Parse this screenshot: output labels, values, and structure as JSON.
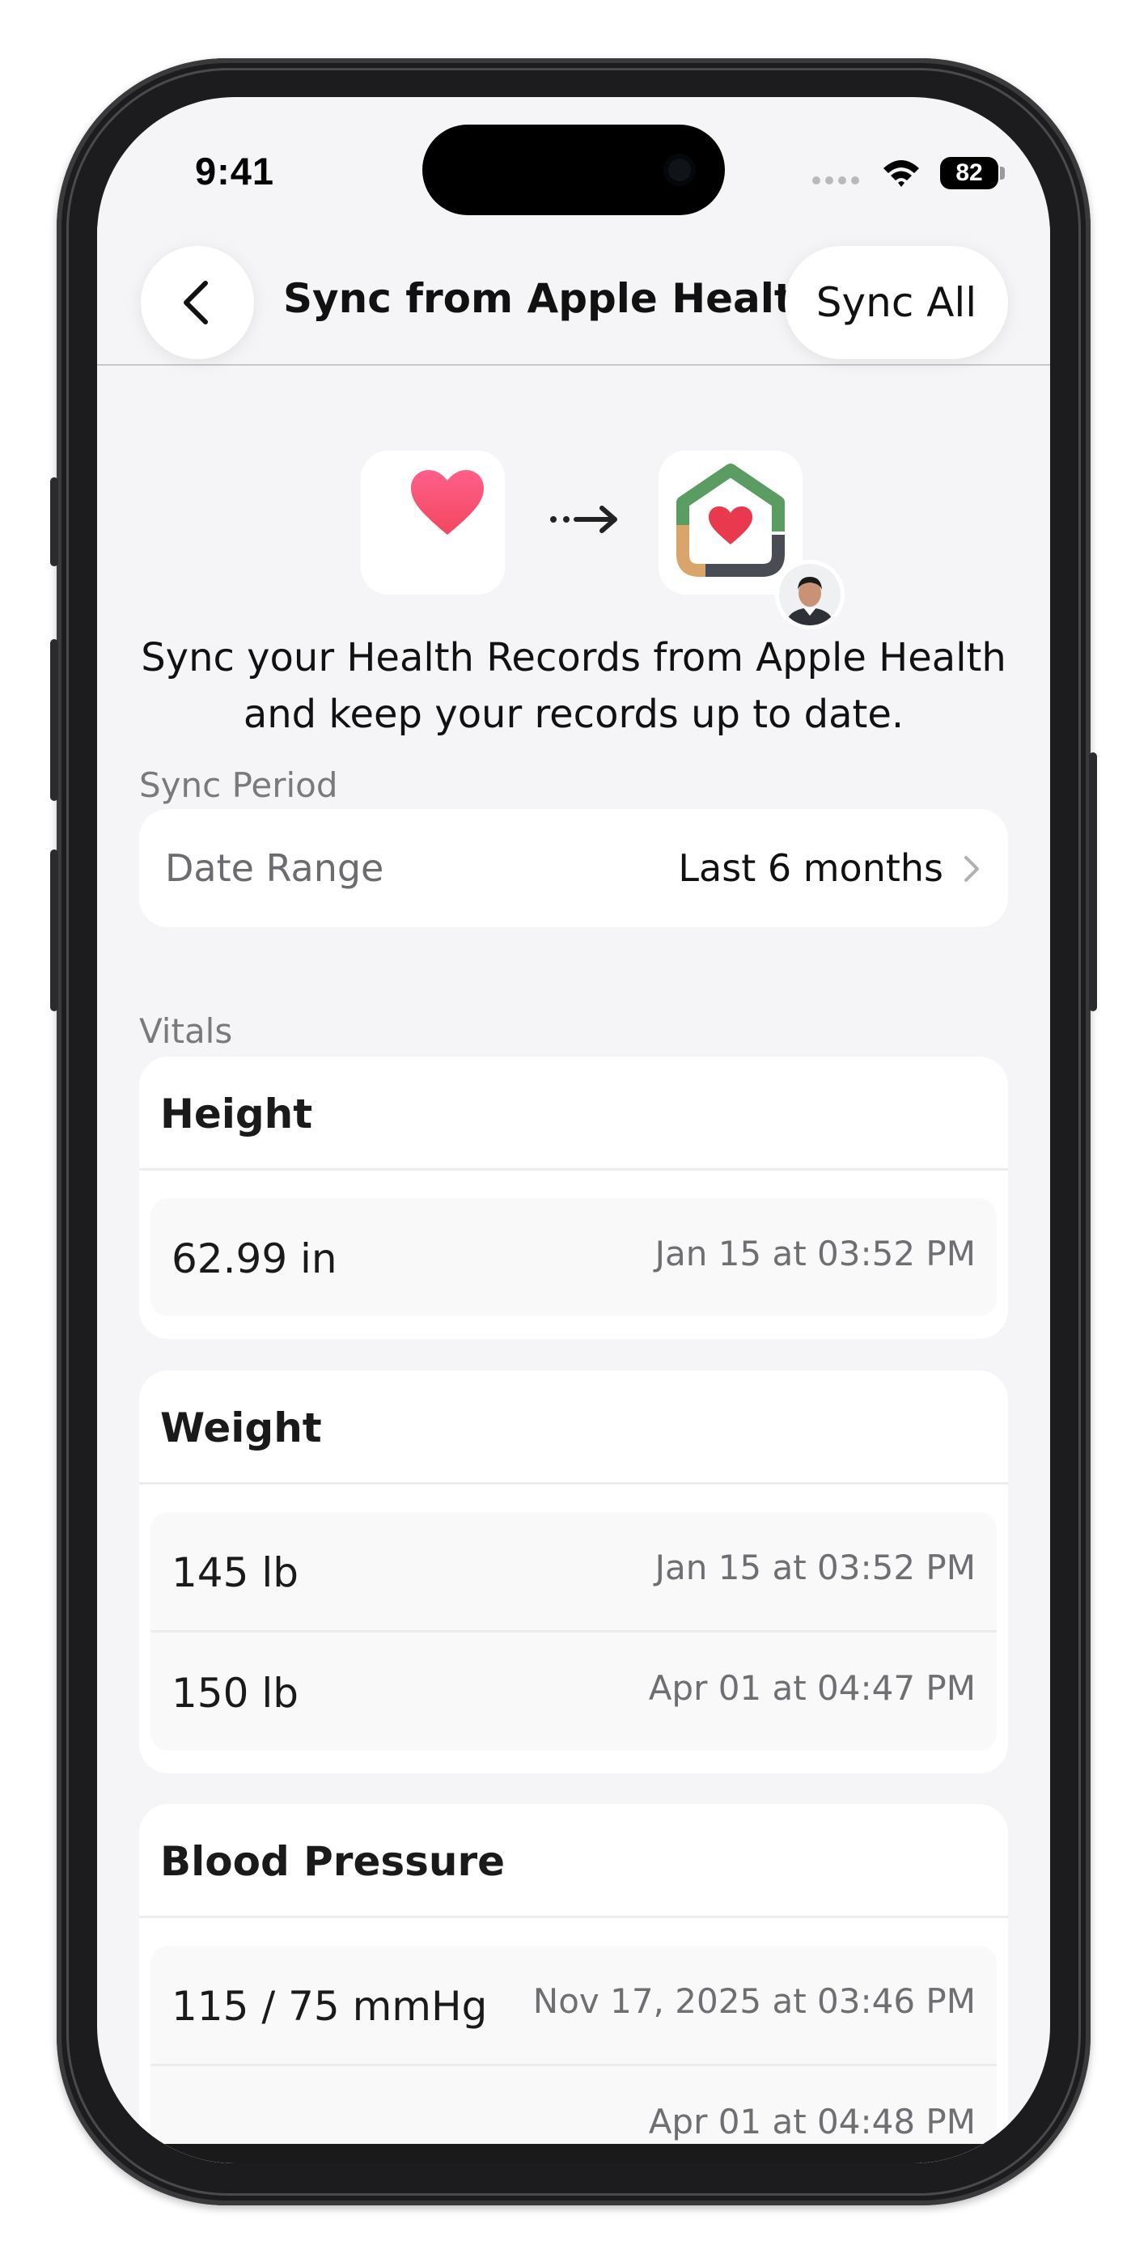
{
  "status_bar": {
    "time": "9:41",
    "battery": "82"
  },
  "nav": {
    "title": "Sync from Apple Health",
    "sync_all_label": "Sync All"
  },
  "intro": {
    "text": "Sync your Health Records from Apple Health and keep your records up to date."
  },
  "sync_period": {
    "section_label": "Sync Period",
    "row_label": "Date Range",
    "row_value": "Last 6 months"
  },
  "vitals": {
    "section_label": "Vitals",
    "groups": [
      {
        "title": "Height",
        "entries": [
          {
            "value": "62.99 in",
            "date": "Jan 15 at 03:52 PM"
          }
        ]
      },
      {
        "title": "Weight",
        "entries": [
          {
            "value": "145 lb",
            "date": "Jan 15 at 03:52 PM"
          },
          {
            "value": "150 lb",
            "date": "Apr 01 at 04:47 PM"
          }
        ]
      },
      {
        "title": "Blood Pressure",
        "entries": [
          {
            "value": "115 / 75 mmHg",
            "date": "Nov 17, 2025 at 03:46 PM"
          },
          {
            "value": "",
            "date": "Apr 01 at 04:48 PM"
          }
        ]
      }
    ]
  },
  "icons": {
    "back": "chevron-left-icon",
    "health": "heart-icon",
    "arrow": "arrow-right-icon",
    "app": "house-heart-icon",
    "chevron": "chevron-right-icon"
  },
  "colors": {
    "heart": "#f2475f",
    "house_green": "#5a9c62",
    "house_tan": "#d9a56b",
    "house_dark": "#4a4c55"
  }
}
